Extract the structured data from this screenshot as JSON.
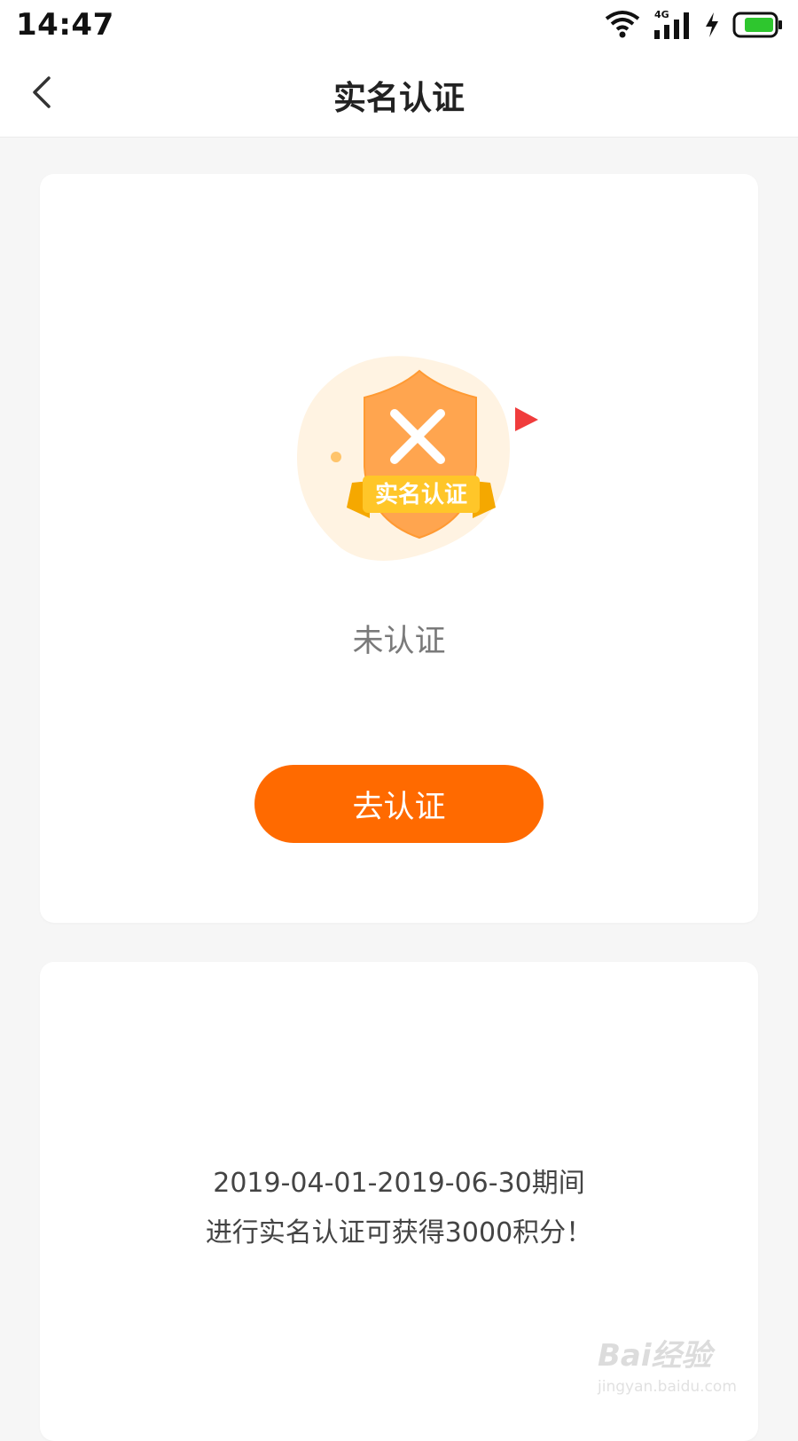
{
  "status_bar": {
    "time": "14:47",
    "network": "4G",
    "icons": [
      "wifi-icon",
      "signal-icon",
      "charging-icon",
      "battery-icon"
    ]
  },
  "nav": {
    "title": "实名认证",
    "back_icon": "chevron-left-icon"
  },
  "status_card": {
    "badge_label": "实名认证",
    "badge_icon": "cross-icon",
    "status_text": "未认证",
    "button_label": "去认证"
  },
  "info_card": {
    "line1": "2019-04-01-2019-06-30期间",
    "line2": "进行实名认证可获得3000积分！"
  },
  "watermark": {
    "main": "Bai经验",
    "sub": "jingyan.baidu.com"
  },
  "colors": {
    "accent": "#ff6a00",
    "shield": "#ffa54f",
    "ribbon": "#ffc629",
    "flag": "#f03c3c",
    "blob": "#fff3e2"
  }
}
